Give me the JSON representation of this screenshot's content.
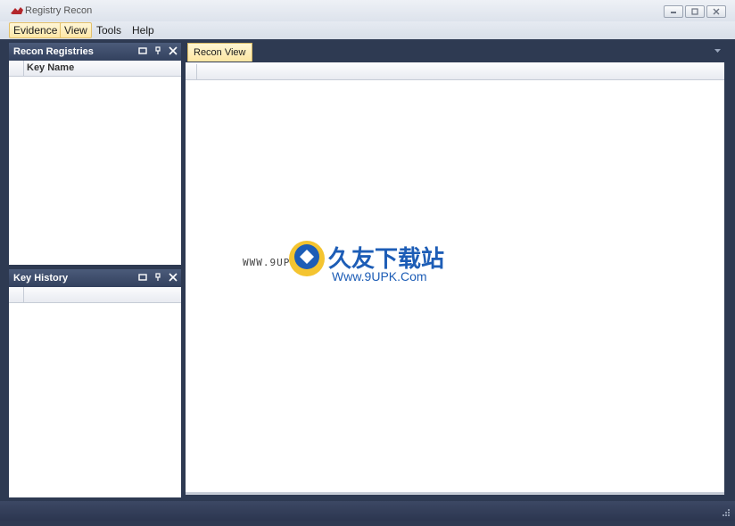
{
  "window": {
    "title": "Registry Recon",
    "controls": [
      "minimize-icon",
      "restore-icon",
      "close-icon"
    ]
  },
  "menubar": {
    "items": [
      {
        "label": "Evidence",
        "active": true
      },
      {
        "label": "View",
        "active": true
      },
      {
        "label": "Tools",
        "active": false
      },
      {
        "label": "Help",
        "active": false
      }
    ]
  },
  "panels": {
    "recon_registries": {
      "title": "Recon Registries",
      "column": "Key Name",
      "buttons": [
        "float-icon",
        "pin-icon",
        "close-icon"
      ]
    },
    "key_history": {
      "title": "Key History",
      "column": "",
      "buttons": [
        "float-icon",
        "pin-icon",
        "close-icon"
      ]
    }
  },
  "document": {
    "tab_label": "Recon View",
    "dropdown": "chevron-down-icon"
  },
  "watermark": {
    "url": "WWW.9UPK.COM",
    "cn": "久友下载站",
    "en": "Www.9UPK.Com"
  },
  "colors": {
    "workspace": "#2e3a52",
    "panel_header": "#3f4e6c",
    "tab_active": "#fde6a2",
    "watermark_blue": "#1d5db6"
  }
}
